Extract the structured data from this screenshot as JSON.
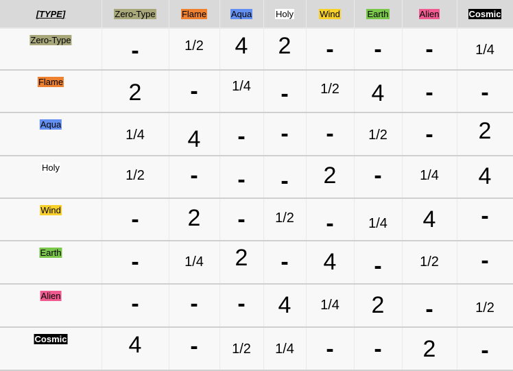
{
  "header": {
    "corner_label": "[TYPE]",
    "columns": [
      {
        "label": "Zero-Type",
        "bg": "#a8a77a",
        "fg": "#000000"
      },
      {
        "label": "Flame",
        "bg": "#ee8130",
        "fg": "#000000"
      },
      {
        "label": "Aqua",
        "bg": "#6390f0",
        "fg": "#000000"
      },
      {
        "label": "Holy",
        "bg": "#ffffff",
        "fg": "#000000"
      },
      {
        "label": "Wind",
        "bg": "#f7d02c",
        "fg": "#000000"
      },
      {
        "label": "Earth",
        "bg": "#7ac74c",
        "fg": "#000000"
      },
      {
        "label": "Alien",
        "bg": "#ef5a8f",
        "fg": "#000000"
      },
      {
        "label": "Cosmic",
        "bg": "#000000",
        "fg": "#ffffff"
      }
    ]
  },
  "rows": [
    {
      "label": "Zero-Type",
      "bg": "#a8a77a",
      "fg": "#000000",
      "values": [
        "-",
        "1/2",
        "4",
        "2",
        "-",
        "-",
        "-",
        "1/4"
      ]
    },
    {
      "label": "Flame",
      "bg": "#ee8130",
      "fg": "#000000",
      "values": [
        "2",
        "-",
        "1/4",
        "-",
        "1/2",
        "4",
        "-",
        "-"
      ]
    },
    {
      "label": "Aqua",
      "bg": "#6390f0",
      "fg": "#000000",
      "values": [
        "1/4",
        "4",
        "-",
        "-",
        "-",
        "1/2",
        "-",
        "2"
      ]
    },
    {
      "label": "Holy",
      "bg": "#ffffff",
      "fg": "#000000",
      "values": [
        "1/2",
        "-",
        "-",
        "-",
        "2",
        "-",
        "1/4",
        "4"
      ]
    },
    {
      "label": "Wind",
      "bg": "#f7d02c",
      "fg": "#000000",
      "values": [
        "-",
        "2",
        "-",
        "1/2",
        "-",
        "1/4",
        "4",
        "-"
      ]
    },
    {
      "label": "Earth",
      "bg": "#7ac74c",
      "fg": "#000000",
      "values": [
        "-",
        "1/4",
        "2",
        "-",
        "4",
        "-",
        "1/2",
        "-"
      ]
    },
    {
      "label": "Alien",
      "bg": "#ef5a8f",
      "fg": "#000000",
      "values": [
        "-",
        "-",
        "-",
        "4",
        "1/4",
        "2",
        "-",
        "1/2"
      ]
    },
    {
      "label": "Cosmic",
      "bg": "#000000",
      "fg": "#ffffff",
      "values": [
        "4",
        "-",
        "1/2",
        "1/4",
        "-",
        "-",
        "2",
        "-"
      ]
    }
  ]
}
